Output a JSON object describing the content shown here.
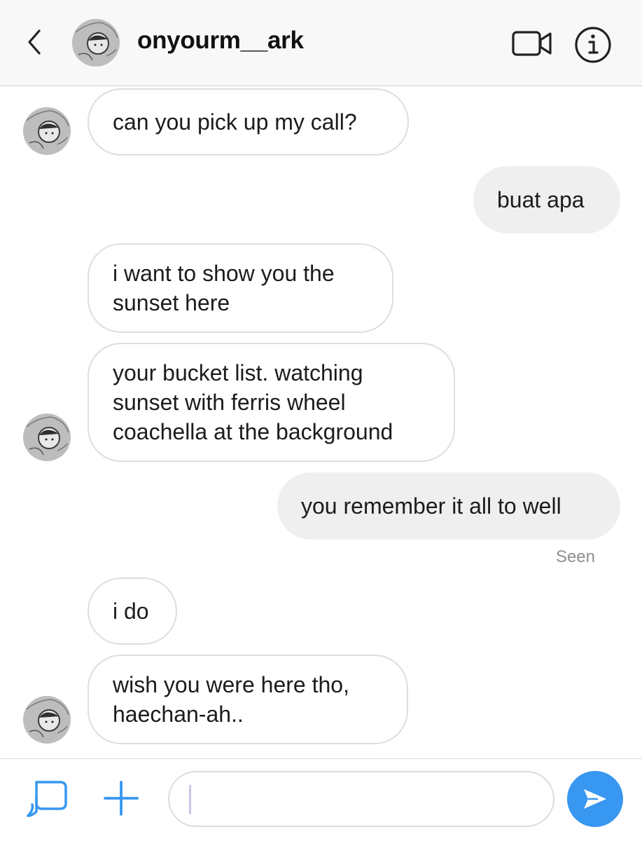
{
  "header": {
    "username": "onyourm__ark",
    "back_icon": "chevron-left-icon",
    "video_icon": "video-call-icon",
    "info_icon": "info-icon"
  },
  "messages": [
    {
      "from": "them",
      "text": "can you pick up my call?"
    },
    {
      "from": "me",
      "text": "buat apa"
    },
    {
      "from": "them",
      "lines": [
        "i want to show you the",
        "sunset here"
      ]
    },
    {
      "from": "them",
      "lines": [
        "your bucket list. watching",
        "sunset with ferris wheel",
        "coachella at the background"
      ]
    },
    {
      "from": "me",
      "text": "you remember it all to well"
    },
    {
      "from": "them",
      "text": "i do"
    },
    {
      "from": "them",
      "lines": [
        "wish you were here tho,",
        "haechan-ah.."
      ]
    }
  ],
  "seen_label": "Seen",
  "composer": {
    "placeholder": "",
    "gallery_icon": "gallery-icon",
    "plus_icon": "plus-icon",
    "send_icon": "send-icon"
  },
  "colors": {
    "accent": "#3897f0",
    "bubble_out": "#efefef",
    "bubble_border": "#dedede",
    "header_bg": "#f8f8f8"
  }
}
